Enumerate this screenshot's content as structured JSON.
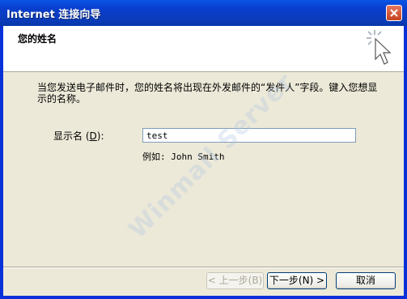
{
  "window": {
    "title": "Internet 连接向导"
  },
  "header": {
    "title": "您的姓名"
  },
  "content": {
    "intro": "当您发送电子邮件时，您的姓名将出现在外发邮件的“发件人”字段。键入您想显示的名称。",
    "field_label_text": "显示名",
    "field_label_hotkey": "D",
    "field_label_suffix": "):",
    "display_name_value": "test",
    "example": "例如: John Smith"
  },
  "buttons": {
    "back": "< 上一步(B)",
    "next": "下一步(N) >",
    "cancel": "取消"
  },
  "watermark": "Winmail Server",
  "colors": {
    "titlebar": "#0a3fcf",
    "window_bg": "#ece9d8",
    "header_bg": "#ffffff"
  }
}
